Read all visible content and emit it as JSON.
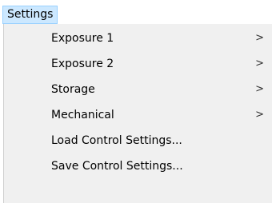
{
  "menubar": {
    "settings_label": "Settings"
  },
  "menu": {
    "items": [
      {
        "label": "Exposure 1",
        "has_submenu": true,
        "arrow": ">"
      },
      {
        "label": "Exposure 2",
        "has_submenu": true,
        "arrow": ">"
      },
      {
        "label": "Storage",
        "has_submenu": true,
        "arrow": ">"
      },
      {
        "label": "Mechanical",
        "has_submenu": true,
        "arrow": ">"
      },
      {
        "label": "Load Control Settings...",
        "has_submenu": false
      },
      {
        "label": "Save Control Settings...",
        "has_submenu": false
      }
    ]
  },
  "colors": {
    "menubar_highlight": "#cce8ff",
    "menubar_highlight_border": "#99d1ff",
    "menu_background": "#f0f0f0"
  }
}
